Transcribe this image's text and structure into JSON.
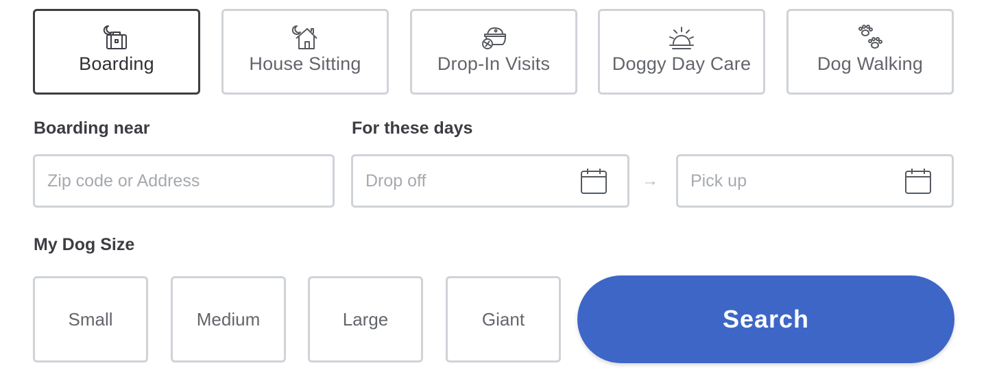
{
  "services": [
    {
      "label": "Boarding",
      "icon": "suitcase-moon-icon",
      "selected": true
    },
    {
      "label": "House Sitting",
      "icon": "house-moon-icon",
      "selected": false
    },
    {
      "label": "Drop-In Visits",
      "icon": "dog-bowl-icon",
      "selected": false
    },
    {
      "label": "Doggy Day Care",
      "icon": "sun-icon",
      "selected": false
    },
    {
      "label": "Dog Walking",
      "icon": "paw-prints-icon",
      "selected": false
    }
  ],
  "location": {
    "label": "Boarding near",
    "placeholder": "Zip code or Address"
  },
  "dates": {
    "label": "For these days",
    "dropoff_placeholder": "Drop off",
    "pickup_placeholder": "Pick up",
    "arrow_icon": "arrow-right-icon",
    "calendar_icon": "calendar-icon"
  },
  "dog_size": {
    "label": "My Dog Size",
    "options": [
      "Small",
      "Medium",
      "Large",
      "Giant"
    ]
  },
  "search": {
    "label": "Search",
    "color": "#3d66c7"
  },
  "colors": {
    "border": "#cfd3d8",
    "selected_border": "#3c3d42",
    "placeholder": "#a6a9ae"
  }
}
